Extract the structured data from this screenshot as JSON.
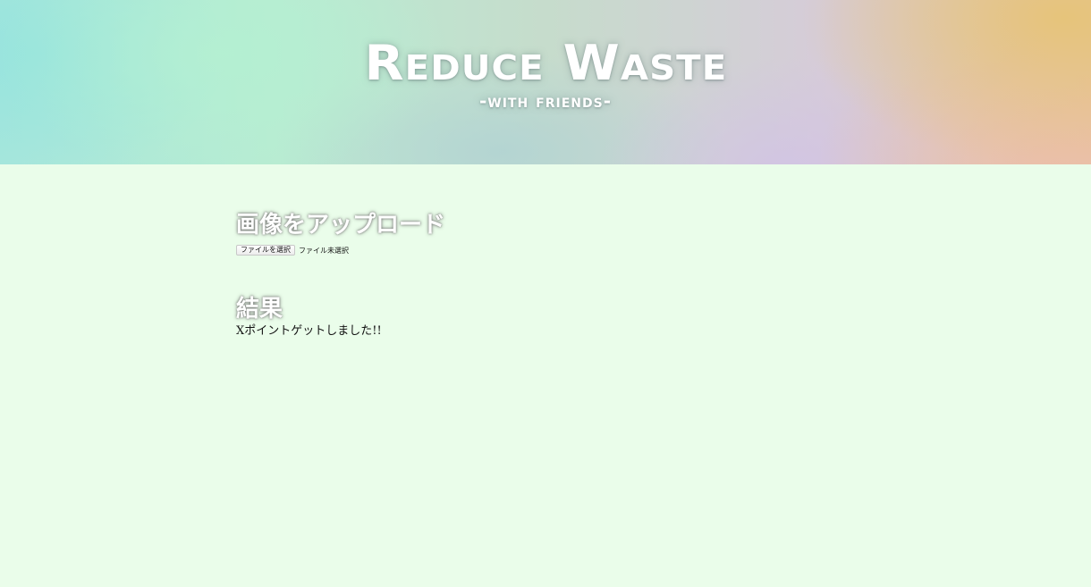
{
  "header": {
    "title": "Reduce Waste",
    "subtitle": "-with friends-"
  },
  "upload": {
    "heading": "画像をアップロード",
    "button_label": "ファイルを選択",
    "file_status": "ファイル未選択"
  },
  "result": {
    "heading": "結果",
    "message": "Xポイントゲットしました!!"
  },
  "colors": {
    "page_background": "#eafdea",
    "heading_text": "#ffffff"
  }
}
